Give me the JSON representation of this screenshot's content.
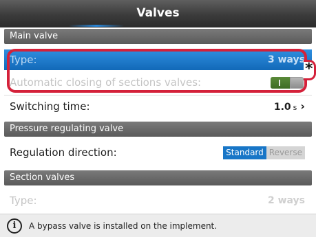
{
  "title": "Valves",
  "main_valve": {
    "header": "Main valve",
    "type_label": "Type:",
    "type_value": "3 ways",
    "auto_close_label": "Automatic closing of sections valves:",
    "auto_close_state": "on",
    "auto_close_mark": "I",
    "switching_label": "Switching time:",
    "switching_value": "1.0",
    "switching_unit": "s",
    "chevron": "›"
  },
  "pressure_valve": {
    "header": "Pressure regulating valve",
    "direction_label": "Regulation direction:",
    "options": [
      "Standard",
      "Reverse"
    ],
    "selected": "Standard"
  },
  "section_valves": {
    "header": "Section valves",
    "type_label": "Type:",
    "type_value": "2 ways"
  },
  "callout_marker": "*",
  "footer": {
    "icon_glyph": "i",
    "message": "A bypass valve is installed on the implement."
  },
  "colors": {
    "highlight": "#d4213a",
    "selected": "#1a75c8",
    "toggle_on": "#4a7a2e"
  }
}
